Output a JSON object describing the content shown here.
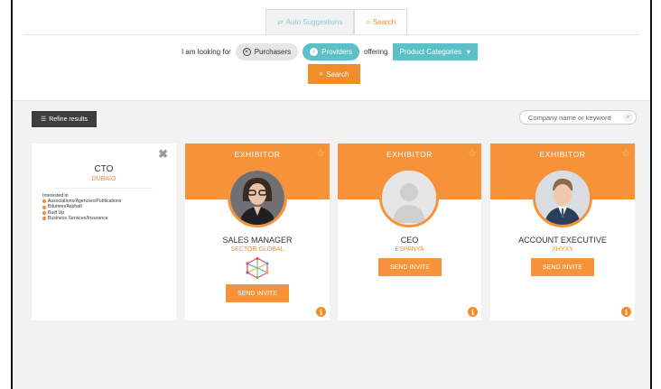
{
  "tabs": [
    {
      "label": "Auto Suggestions",
      "icon": "shuffle-icon"
    },
    {
      "label": "Search",
      "icon": "search-icon"
    }
  ],
  "search_bar": {
    "prefix": "I am looking for",
    "option_purchasers": "Purchasers",
    "option_providers": "Providers",
    "offering": "offering",
    "category_select": "Product Categories",
    "search_button": "Search"
  },
  "toolbar": {
    "refine_label": "Refine results",
    "keyword_placeholder": "Company name or keyword"
  },
  "filter_card": {
    "title": "CTO",
    "location": "DUBAIO",
    "interested_label": "Interested in",
    "interests": [
      "Associations/Agencies/Publications",
      "Bitumen/Asphalt",
      "Built Up",
      "Business Services/Insurance"
    ]
  },
  "exhibitors": [
    {
      "badge": "EXHIBITOR",
      "title": "SALES MANAGER",
      "company": "SECTOR GLOBAL",
      "invite": "SEND INVITE",
      "avatar": "woman-photo",
      "has_logo": true
    },
    {
      "badge": "EXHIBITOR",
      "title": "CEO",
      "company": "ESPANYA",
      "invite": "SEND INVITE",
      "avatar": "placeholder-person-icon",
      "has_logo": false
    },
    {
      "badge": "EXHIBITOR",
      "title": "ACCOUNT EXECUTIVE",
      "company": "XHYXY",
      "invite": "SEND INVITE",
      "avatar": "man-photo",
      "has_logo": false
    }
  ],
  "colors": {
    "accent_orange": "#f5923a",
    "accent_teal": "#5bc0c8",
    "dark_button": "#3d3d3d",
    "background": "#f2f2f2"
  }
}
